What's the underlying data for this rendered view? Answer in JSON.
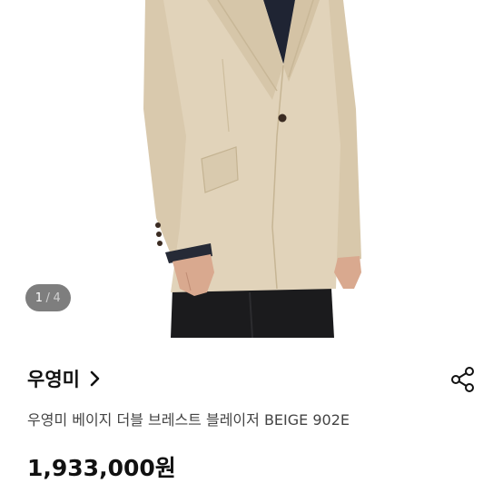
{
  "gallery": {
    "current_page": "1",
    "separator": "/",
    "total_pages": "4"
  },
  "shop": {
    "name": "우영미"
  },
  "product": {
    "title": "우영미 베이지 더블 브레스트 블레이저 BEIGE 902E",
    "price": "1,933,000원"
  },
  "icons": {
    "chevron": "chevron-right-icon",
    "share": "share-icon"
  },
  "colors": {
    "jacket": "#e1d3ba",
    "trousers": "#1b1b1d",
    "shirt": "#1f2433",
    "skin": "#d9a98f"
  }
}
